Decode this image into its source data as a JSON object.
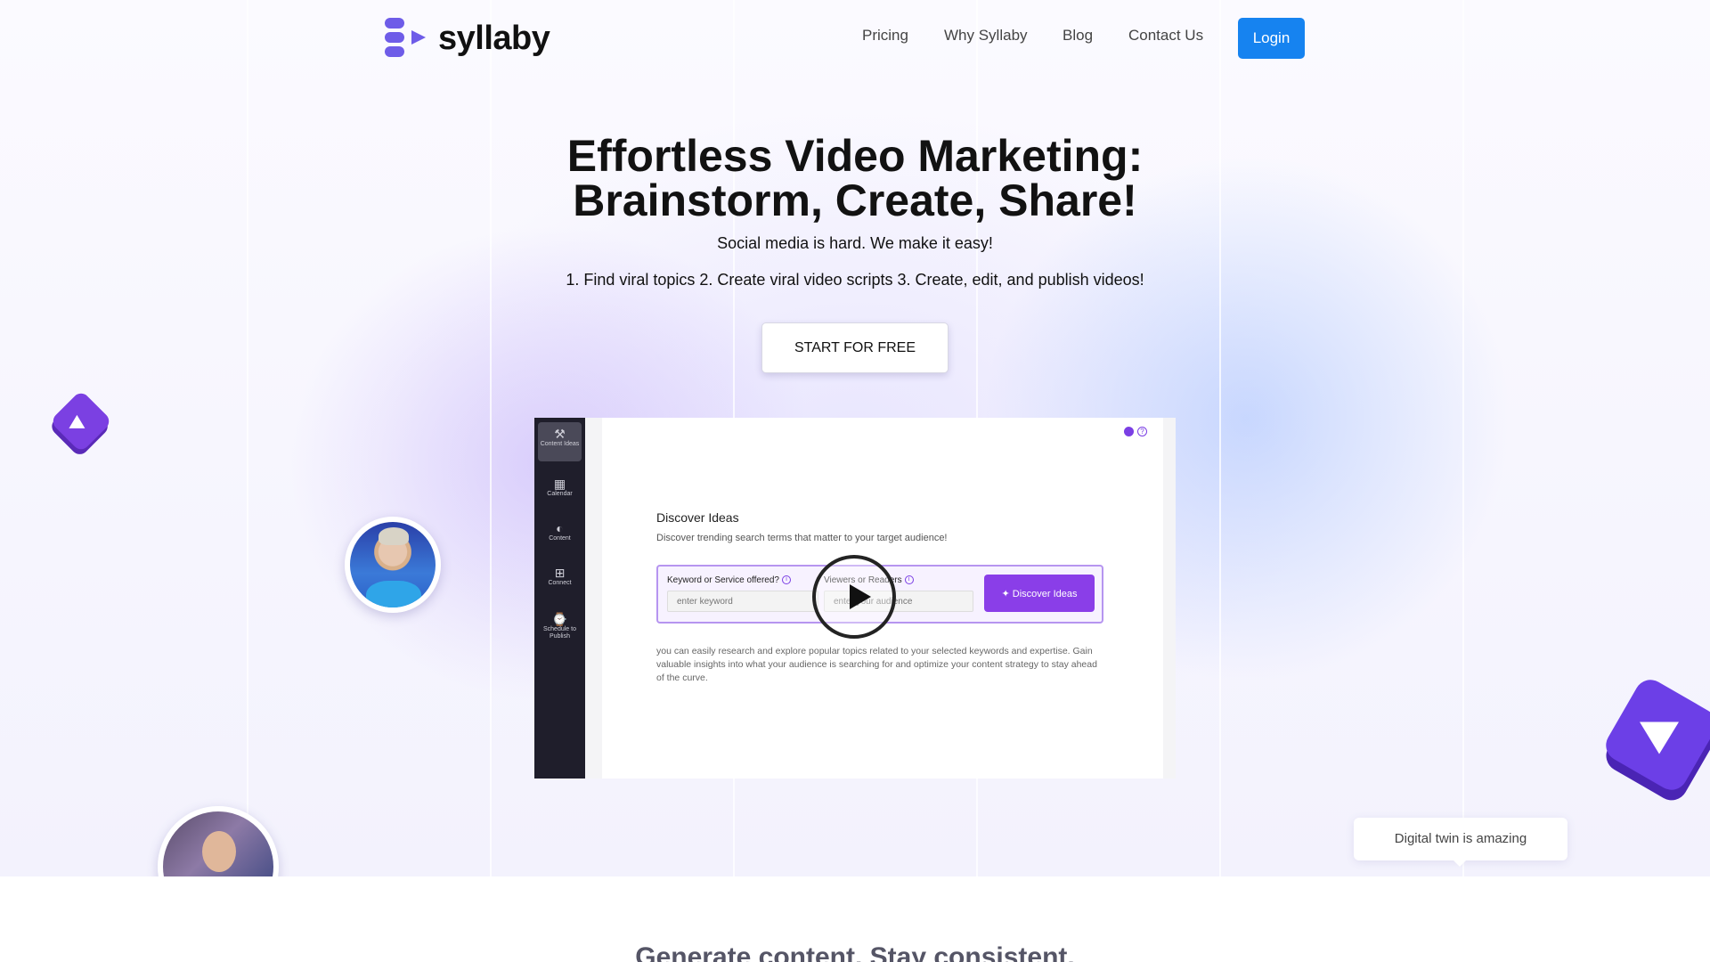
{
  "brand": {
    "name": "syllaby",
    "colors": {
      "accent": "#1683f0",
      "purple": "#7b40e2",
      "logo_purple": "#6e5ce8"
    }
  },
  "nav": {
    "items": [
      "Pricing",
      "Why Syllaby",
      "Blog",
      "Contact Us"
    ],
    "login_label": "Login"
  },
  "hero": {
    "headline_line1": "Effortless Video Marketing:",
    "headline_line2": "Brainstorm, Create, Share!",
    "subtitle": "Social media is hard. We make it easy!",
    "steps": "1. Find viral topics 2. Create viral video scripts 3. Create, edit, and publish videos!",
    "cta_label": "START FOR FREE"
  },
  "app_preview": {
    "sidebar": [
      {
        "label": "Content Ideas",
        "icon": "wrench-icon"
      },
      {
        "label": "Calendar",
        "icon": "calendar-icon"
      },
      {
        "label": "Content",
        "icon": "content-icon"
      },
      {
        "label": "Connect",
        "icon": "plus-square-icon"
      },
      {
        "label": "Schedule to Publish",
        "icon": "schedule-icon"
      }
    ],
    "title": "Discover Ideas",
    "subtitle": "Discover trending search terms that matter to your target audience!",
    "field1_label": "Keyword or Service offered?",
    "field1_placeholder": "enter keyword",
    "field2_label": "Viewers or Readers",
    "field2_placeholder": "enter your audience",
    "button_label": "Discover Ideas",
    "description": "you can easily research and explore popular topics related to your selected keywords and expertise. Gain valuable insights into what your audience is searching for and optimize your content strategy to stay ahead of the curve."
  },
  "bubble": {
    "text": "Digital twin is amazing"
  },
  "section": {
    "title": "Generate content. Stay consistent."
  }
}
